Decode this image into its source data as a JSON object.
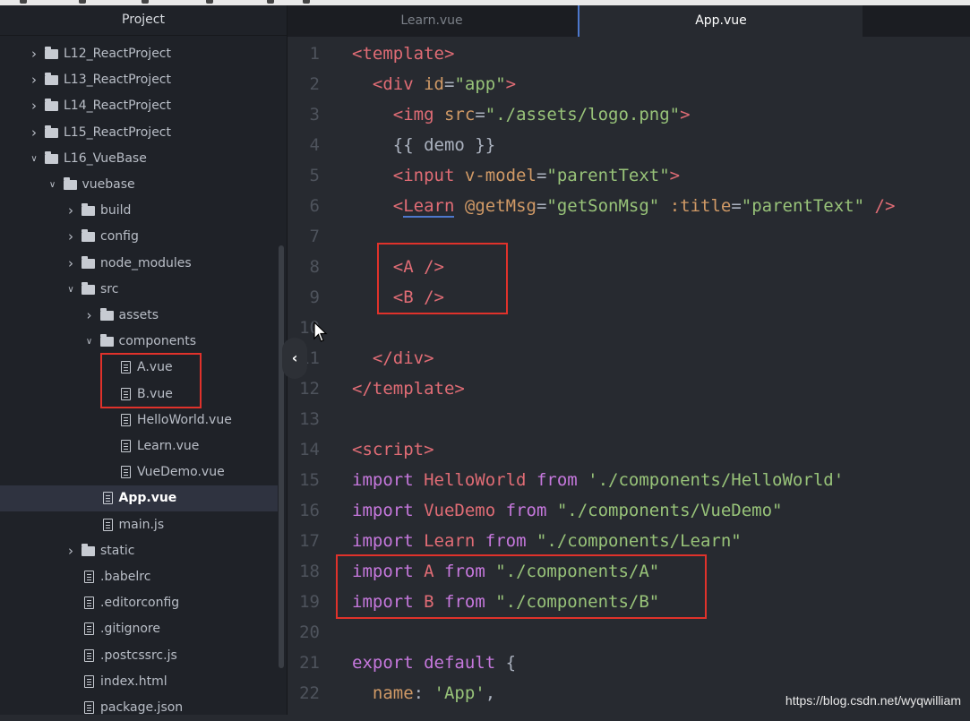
{
  "sidebar": {
    "title": "Project",
    "tree": [
      {
        "label": "L12_ReactProject",
        "type": "folder",
        "depth": 0,
        "expanded": false
      },
      {
        "label": "L13_ReactProject",
        "type": "folder",
        "depth": 0,
        "expanded": false
      },
      {
        "label": "L14_ReactProject",
        "type": "folder",
        "depth": 0,
        "expanded": false
      },
      {
        "label": "L15_ReactProject",
        "type": "folder",
        "depth": 0,
        "expanded": false
      },
      {
        "label": "L16_VueBase",
        "type": "folder",
        "depth": 0,
        "expanded": true
      },
      {
        "label": "vuebase",
        "type": "folder",
        "depth": 1,
        "expanded": true
      },
      {
        "label": "build",
        "type": "folder",
        "depth": 2,
        "expanded": false
      },
      {
        "label": "config",
        "type": "folder",
        "depth": 2,
        "expanded": false
      },
      {
        "label": "node_modules",
        "type": "folder",
        "depth": 2,
        "expanded": false
      },
      {
        "label": "src",
        "type": "folder",
        "depth": 2,
        "expanded": true
      },
      {
        "label": "assets",
        "type": "folder",
        "depth": 3,
        "expanded": false
      },
      {
        "label": "components",
        "type": "folder",
        "depth": 3,
        "expanded": true
      },
      {
        "label": "A.vue",
        "type": "file",
        "depth": 4
      },
      {
        "label": "B.vue",
        "type": "file",
        "depth": 4
      },
      {
        "label": "HelloWorld.vue",
        "type": "file",
        "depth": 4
      },
      {
        "label": "Learn.vue",
        "type": "file",
        "depth": 4
      },
      {
        "label": "VueDemo.vue",
        "type": "file",
        "depth": 4
      },
      {
        "label": "App.vue",
        "type": "file",
        "depth": 3,
        "selected": true
      },
      {
        "label": "main.js",
        "type": "file",
        "depth": 3
      },
      {
        "label": "static",
        "type": "folder",
        "depth": 2,
        "expanded": false
      },
      {
        "label": ".babelrc",
        "type": "file",
        "depth": 2
      },
      {
        "label": ".editorconfig",
        "type": "file",
        "depth": 2
      },
      {
        "label": ".gitignore",
        "type": "file",
        "depth": 2
      },
      {
        "label": ".postcssrc.js",
        "type": "file",
        "depth": 2
      },
      {
        "label": "index.html",
        "type": "file",
        "depth": 2
      },
      {
        "label": "package.json",
        "type": "file",
        "depth": 2
      }
    ]
  },
  "tabs": [
    {
      "label": "Learn.vue",
      "active": false
    },
    {
      "label": "App.vue",
      "active": true
    }
  ],
  "editor": {
    "lines": [
      {
        "n": "1",
        "tokens": [
          [
            "tag",
            "<template>"
          ]
        ]
      },
      {
        "n": "2",
        "tokens": [
          [
            "plain",
            "  "
          ],
          [
            "tag",
            "<div"
          ],
          [
            "plain",
            " "
          ],
          [
            "attr",
            "id"
          ],
          [
            "plain",
            "="
          ],
          [
            "str",
            "\"app\""
          ],
          [
            "tag",
            ">"
          ]
        ]
      },
      {
        "n": "3",
        "tokens": [
          [
            "plain",
            "    "
          ],
          [
            "tag",
            "<img"
          ],
          [
            "plain",
            " "
          ],
          [
            "attr",
            "src"
          ],
          [
            "plain",
            "="
          ],
          [
            "str",
            "\"./assets/logo.png\""
          ],
          [
            "tag",
            ">"
          ]
        ]
      },
      {
        "n": "4",
        "tokens": [
          [
            "plain",
            "    {{ demo }}"
          ]
        ]
      },
      {
        "n": "5",
        "tokens": [
          [
            "plain",
            "    "
          ],
          [
            "tag",
            "<input"
          ],
          [
            "plain",
            " "
          ],
          [
            "attr",
            "v-model"
          ],
          [
            "plain",
            "="
          ],
          [
            "str",
            "\"parentText\""
          ],
          [
            "tag",
            ">"
          ]
        ]
      },
      {
        "n": "6",
        "tokens": [
          [
            "plain",
            "    "
          ],
          [
            "tag",
            "<"
          ],
          [
            "under",
            "Learn"
          ],
          [
            "plain",
            " "
          ],
          [
            "attr",
            "@getMsg"
          ],
          [
            "plain",
            "="
          ],
          [
            "str",
            "\"getSonMsg\""
          ],
          [
            "plain",
            " "
          ],
          [
            "attr",
            ":title"
          ],
          [
            "plain",
            "="
          ],
          [
            "str",
            "\"parentText\""
          ],
          [
            "plain",
            " "
          ],
          [
            "tag",
            "/>"
          ]
        ]
      },
      {
        "n": "7",
        "tokens": []
      },
      {
        "n": "8",
        "tokens": [
          [
            "plain",
            "    "
          ],
          [
            "tag",
            "<A"
          ],
          [
            "plain",
            " "
          ],
          [
            "tag",
            "/>"
          ]
        ]
      },
      {
        "n": "9",
        "tokens": [
          [
            "plain",
            "    "
          ],
          [
            "tag",
            "<B"
          ],
          [
            "plain",
            " "
          ],
          [
            "tag",
            "/>"
          ]
        ]
      },
      {
        "n": "10",
        "tokens": []
      },
      {
        "n": "11",
        "tokens": [
          [
            "plain",
            "  "
          ],
          [
            "tag",
            "</div>"
          ]
        ]
      },
      {
        "n": "12",
        "tokens": [
          [
            "tag",
            "</template>"
          ]
        ]
      },
      {
        "n": "13",
        "tokens": []
      },
      {
        "n": "14",
        "tokens": [
          [
            "tag",
            "<script>"
          ]
        ]
      },
      {
        "n": "15",
        "tokens": [
          [
            "kw",
            "import"
          ],
          [
            "plain",
            " "
          ],
          [
            "var",
            "HelloWorld"
          ],
          [
            "plain",
            " "
          ],
          [
            "kw",
            "from"
          ],
          [
            "plain",
            " "
          ],
          [
            "str",
            "'./components/HelloWorld'"
          ]
        ]
      },
      {
        "n": "16",
        "tokens": [
          [
            "kw",
            "import"
          ],
          [
            "plain",
            " "
          ],
          [
            "var",
            "VueDemo"
          ],
          [
            "plain",
            " "
          ],
          [
            "kw",
            "from"
          ],
          [
            "plain",
            " "
          ],
          [
            "str",
            "\"./components/VueDemo\""
          ]
        ]
      },
      {
        "n": "17",
        "tokens": [
          [
            "kw",
            "import"
          ],
          [
            "plain",
            " "
          ],
          [
            "var",
            "Learn"
          ],
          [
            "plain",
            " "
          ],
          [
            "kw",
            "from"
          ],
          [
            "plain",
            " "
          ],
          [
            "str",
            "\"./components/Learn\""
          ]
        ]
      },
      {
        "n": "18",
        "tokens": [
          [
            "kw",
            "import"
          ],
          [
            "plain",
            " "
          ],
          [
            "var",
            "A"
          ],
          [
            "plain",
            " "
          ],
          [
            "kw",
            "from"
          ],
          [
            "plain",
            " "
          ],
          [
            "str",
            "\"./components/A\""
          ]
        ]
      },
      {
        "n": "19",
        "tokens": [
          [
            "kw",
            "import"
          ],
          [
            "plain",
            " "
          ],
          [
            "var",
            "B"
          ],
          [
            "plain",
            " "
          ],
          [
            "kw",
            "from"
          ],
          [
            "plain",
            " "
          ],
          [
            "str",
            "\"./components/B\""
          ]
        ]
      },
      {
        "n": "20",
        "tokens": []
      },
      {
        "n": "21",
        "tokens": [
          [
            "kw",
            "export"
          ],
          [
            "plain",
            " "
          ],
          [
            "kw",
            "default"
          ],
          [
            "plain",
            " {"
          ]
        ]
      },
      {
        "n": "22",
        "tokens": [
          [
            "plain",
            "  "
          ],
          [
            "attr",
            "name"
          ],
          [
            "plain",
            ": "
          ],
          [
            "str",
            "'App'"
          ],
          [
            "plain",
            ","
          ]
        ]
      }
    ]
  },
  "collapse_handle": "‹",
  "watermark": "https://blog.csdn.net/wyqwilliam",
  "colors": {
    "highlight_box": "#e0322b",
    "active_tab_accent": "#4d78cc"
  }
}
